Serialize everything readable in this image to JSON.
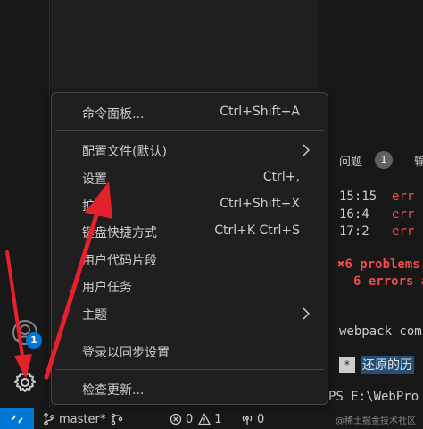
{
  "activity_bar": {
    "account_icon": "account-icon",
    "account_badge": "1",
    "manage_icon": "gear-icon"
  },
  "menu": {
    "items": [
      {
        "label": "命令面板...",
        "shortcut": "Ctrl+Shift+A"
      },
      {
        "label": "配置文件(默认)",
        "submenu": true
      },
      {
        "label": "设置",
        "shortcut": "Ctrl+,"
      },
      {
        "label": "扩",
        "shortcut": "Ctrl+Shift+X"
      },
      {
        "label": "键盘快捷方式",
        "shortcut": "Ctrl+K Ctrl+S"
      },
      {
        "label": "用户代码片段"
      },
      {
        "label": "用户任务"
      },
      {
        "label": "主题",
        "submenu": true
      },
      {
        "label": "登录以同步设置"
      },
      {
        "label": "检查更新..."
      }
    ]
  },
  "panel": {
    "tab_problems": "问题",
    "problems_count": "1",
    "tab_output": "输",
    "lines": [
      {
        "time": "15:15",
        "text": "err"
      },
      {
        "time": "16:4",
        "text": "err"
      },
      {
        "time": "17:2",
        "text": "err"
      }
    ],
    "summary1": "✖6 problems",
    "summary2": "6 errors a",
    "compiled": "webpack comp",
    "restore_star": "*",
    "restore_text": "还原的历",
    "prompt": "PS E:\\WebPro"
  },
  "status_bar": {
    "branch": "master*",
    "errors": "0",
    "warnings": "1",
    "ports": "0",
    "watermark": "@稀土掘金技术社区"
  },
  "colors": {
    "accent": "#0078d4",
    "error": "#f14c4c",
    "annotation": "#e5222c"
  }
}
